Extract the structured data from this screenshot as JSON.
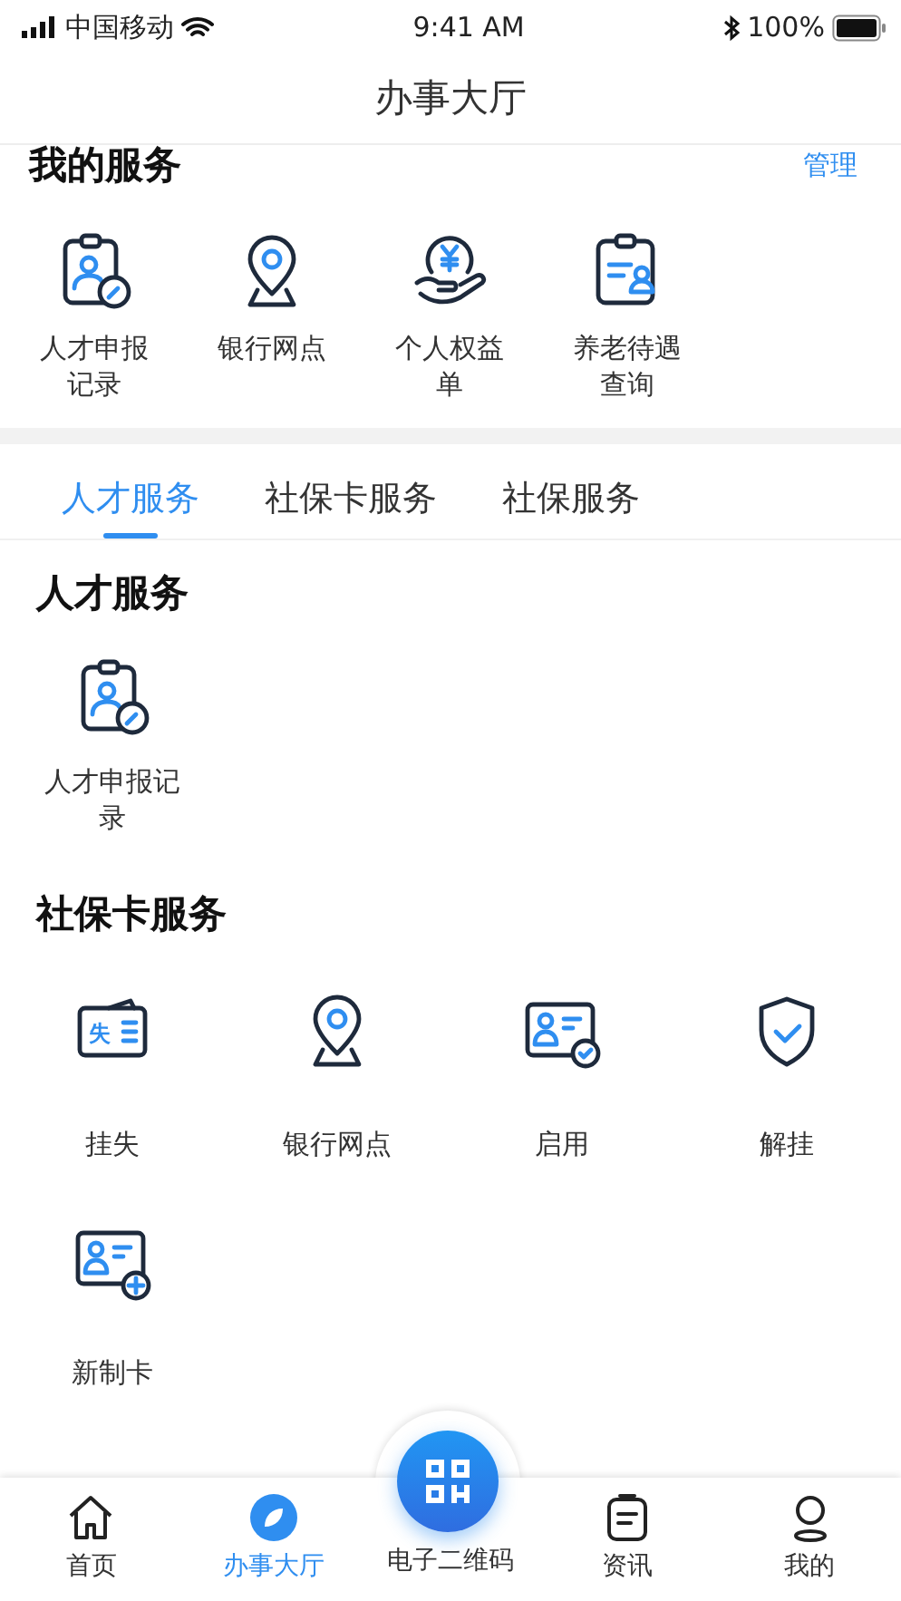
{
  "status_bar": {
    "carrier": "中国移动",
    "time": "9:41 AM",
    "battery": "100%"
  },
  "title": "办事大厅",
  "my_services": {
    "heading": "我的服务",
    "manage": "管理",
    "items": [
      {
        "label": "人才申报记录",
        "kind": "clipboard-pen"
      },
      {
        "label": "银行网点",
        "kind": "pin"
      },
      {
        "label": "个人权益单",
        "kind": "hand-coin"
      },
      {
        "label": "养老待遇查询",
        "kind": "clipboard-person"
      }
    ]
  },
  "tabs": [
    {
      "label": "人才服务",
      "selected": true
    },
    {
      "label": "社保卡服务",
      "selected": false
    },
    {
      "label": "社保服务",
      "selected": false
    }
  ],
  "sections": [
    {
      "heading": "人才服务",
      "items": [
        {
          "label": "人才申报记录",
          "kind": "clipboard-pen"
        }
      ]
    },
    {
      "heading": "社保卡服务",
      "items": [
        {
          "label": "挂失",
          "kind": "card-lost",
          "badge": "失"
        },
        {
          "label": "银行网点",
          "kind": "pin"
        },
        {
          "label": "启用",
          "kind": "card-check"
        },
        {
          "label": "解挂",
          "kind": "shield"
        },
        {
          "label": "新制卡",
          "kind": "card-plus"
        }
      ]
    }
  ],
  "bottom_nav": [
    {
      "label": "首页",
      "kind": "home",
      "selected": false
    },
    {
      "label": "办事大厅",
      "kind": "leaf",
      "selected": true
    },
    {
      "label": "电子二维码",
      "kind": "qr",
      "selected": false
    },
    {
      "label": "资讯",
      "kind": "news",
      "selected": false
    },
    {
      "label": "我的",
      "kind": "person",
      "selected": false
    }
  ]
}
